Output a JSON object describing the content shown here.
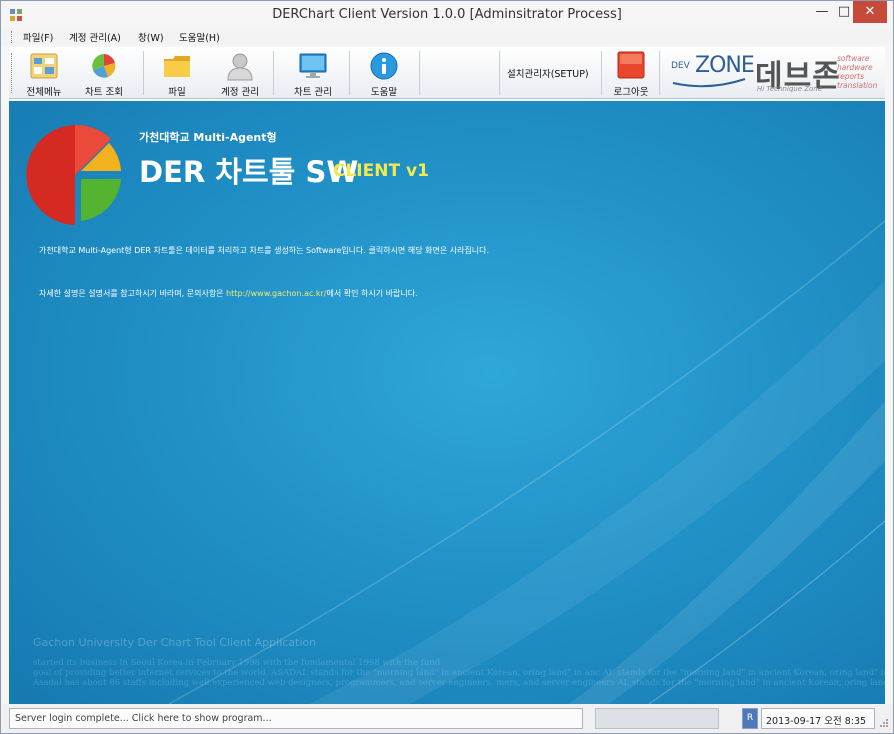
{
  "window": {
    "title": "DERChart Client Version 1.0.0 [Adminsitrator Process]",
    "minimize_glyph": "—",
    "maximize_glyph": "□",
    "close_glyph": "✕"
  },
  "menu": {
    "items": [
      "파일(F)",
      "계정 관리(A)",
      "창(W)",
      "도움말(H)"
    ]
  },
  "toolbar": {
    "buttons": [
      {
        "label": "전체메뉴",
        "icon": "grid-menu-icon"
      },
      {
        "label": "차트 조회",
        "icon": "pie-chart-icon"
      },
      {
        "label": "파일",
        "icon": "folder-icon"
      },
      {
        "label": "계정 관리",
        "icon": "user-icon"
      },
      {
        "label": "차트 관리",
        "icon": "monitor-icon"
      },
      {
        "label": "도움말",
        "icon": "info-icon"
      }
    ],
    "setup_label": "설치관리자(SETUP)",
    "logout_label": "로그아웃"
  },
  "logos": {
    "devzone_small": "DEV",
    "devzone_main": "ZONE",
    "korean_brand": "데브존",
    "korean_sub": "Hi Technique Zone",
    "tags": [
      "software",
      "hardware",
      "reports",
      "translation"
    ]
  },
  "banner": {
    "subtitle": "가천대학교 Multi-Agent형",
    "title": "DER 차트툴 SW",
    "client": "CLIENT v1",
    "desc1": "가천대학교 Multi-Agent형 DER 차트툴은  데이터를 처리하고 차트를 생성하는 Software입니다.  클릭하시면 해당 화면은 사라집니다.",
    "desc2_prefix": "자세한 설명은 설명서를 참고하시기 바라며, 문의사항은 ",
    "desc2_link": "http://www.gachon.ac.kr/",
    "desc2_suffix": "에서 확인 하시기 바랍니다."
  },
  "footer": {
    "title": "Gachon University Der Chart Tool Client Application",
    "lines": [
      " started its business in Seoul Korea in February 1998 with the fundamental 1998 with the fund",
      "goal of providing better internet services to the world. ASADAL stands for the \"morning land\" in ancient Korean, oring land\" in anc AL stands for the \"morning land\" in ancient Korean, oring land\" in anc",
      "Asadal has about 86 staffs including well experienced web designers, programmers, and server engineers. mers, and server engineers AL stands for the \"morning land\" in ancient Korean, oring land\" in anc"
    ]
  },
  "statusbar": {
    "message": "Server login complete... Click here to show program...",
    "r_badge": "R",
    "datetime": "2013-09-17 오전 8:35"
  }
}
